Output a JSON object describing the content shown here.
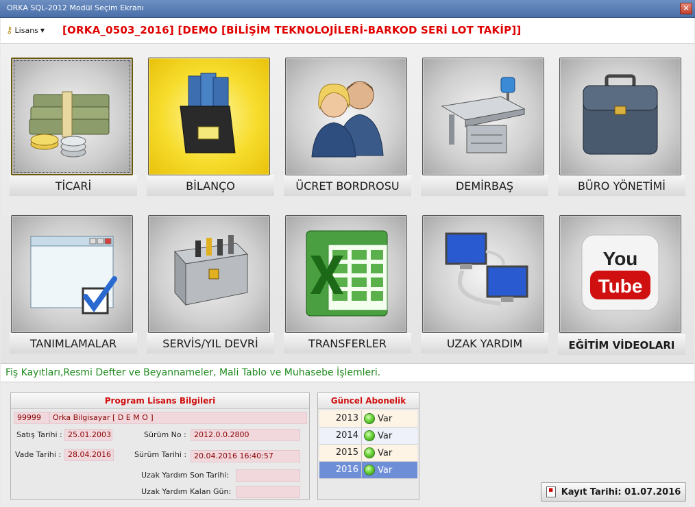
{
  "window": {
    "title": "ORKA SQL-2012  Modül Seçim Ekranı",
    "close": "✕"
  },
  "header": {
    "lisans_label": "Lisans",
    "company": "[ORKA_0503_2016] [DEMO [BİLİŞİM TEKNOLOJİLERİ-BARKOD SERİ LOT TAKİP]]"
  },
  "modules": [
    {
      "label": "TİCARİ",
      "icon": "money-icon"
    },
    {
      "label": "BİLANÇO",
      "icon": "binder-icon"
    },
    {
      "label": "ÜCRET BORDROSU",
      "icon": "people-icon"
    },
    {
      "label": "DEMİRBAŞ",
      "icon": "desk-icon"
    },
    {
      "label": "BÜRO YÖNETİMİ",
      "icon": "briefcase-icon"
    },
    {
      "label": "TANIMLAMALAR",
      "icon": "window-check-icon"
    },
    {
      "label": "SERVİS/YIL DEVRİ",
      "icon": "toolbox-icon"
    },
    {
      "label": "TRANSFERLER",
      "icon": "excel-icon"
    },
    {
      "label": "UZAK YARDIM",
      "icon": "network-icon"
    },
    {
      "label": "EĞİTİM VİDEOLARI",
      "icon": "youtube-icon"
    }
  ],
  "description": "Fiş Kayıtları,Resmi Defter ve Beyannameler, Mali Tablo ve Muhasebe İşlemleri.",
  "license_panel": {
    "title": "Program Lisans Bilgileri",
    "code": "99999",
    "name": "Orka Bilgisayar [ D E M O ]",
    "satis_label": "Satış Tarihi :",
    "satis_value": "25.01.2003",
    "surum_label": "Sürüm No :",
    "surum_value": "2012.0.0.2800",
    "vade_label": "Vade Tarihi :",
    "vade_value": "28.04.2016",
    "surum_tarihi_label": "Sürüm Tarihi :",
    "surum_tarihi_value": "20.04.2016 16:40:57",
    "uzak_son_label": "Uzak Yardım Son Tarihi:",
    "uzak_son_value": "",
    "uzak_kalan_label": "Uzak Yardım Kalan Gün:",
    "uzak_kalan_value": ""
  },
  "subscription_panel": {
    "title": "Güncel Abonelik",
    "rows": [
      {
        "year": "2013",
        "status": "Var"
      },
      {
        "year": "2014",
        "status": "Var"
      },
      {
        "year": "2015",
        "status": "Var"
      },
      {
        "year": "2016",
        "status": "Var"
      }
    ]
  },
  "footer": {
    "kayit": "Kayıt Tarihi: 01.07.2016"
  },
  "colors": {
    "accent_red": "#e00000",
    "desc_green": "#1f8a1f",
    "selected_yellow": "#f7dd2e"
  }
}
